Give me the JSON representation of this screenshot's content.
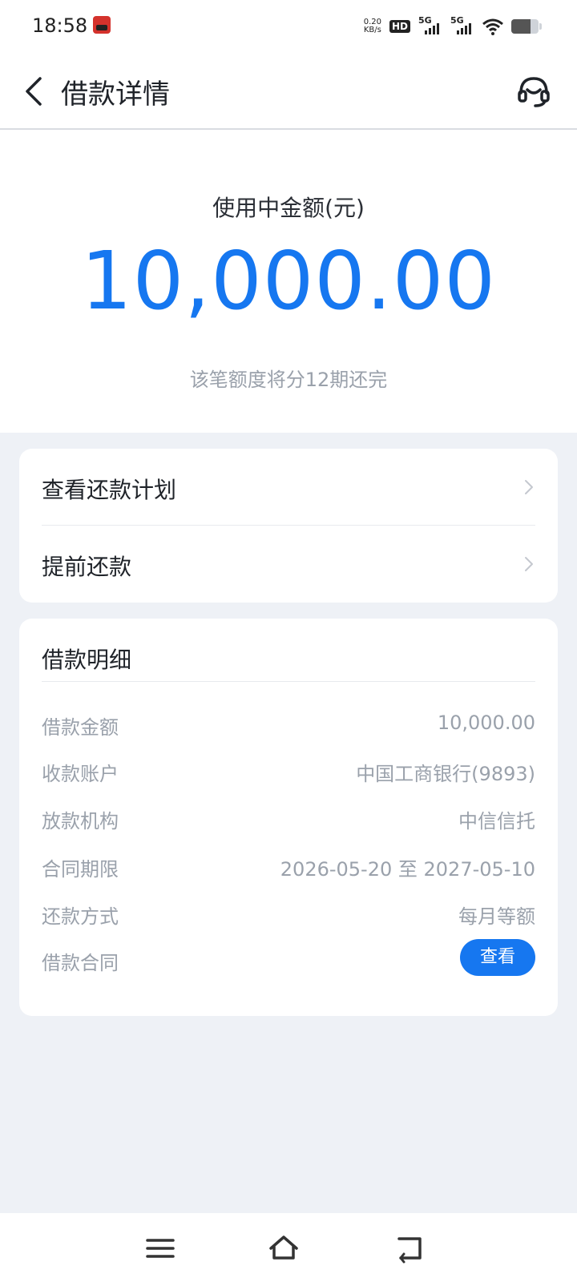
{
  "status": {
    "time": "18:58",
    "net_speed_value": "0.20",
    "net_speed_unit": "KB/s",
    "hd_label": "HD",
    "signal_label_1": "5G",
    "signal_label_2": "5G"
  },
  "header": {
    "title": "借款详情"
  },
  "summary": {
    "label": "使用中金额(元)",
    "amount": "10,000.00",
    "note": "该笔额度将分12期还完"
  },
  "actions": [
    {
      "label": "查看还款计划"
    },
    {
      "label": "提前还款"
    }
  ],
  "details": {
    "title": "借款明细",
    "rows": [
      {
        "key": "借款金额",
        "value": "10,000.00"
      },
      {
        "key": "收款账户",
        "value": "中国工商银行(9893)"
      },
      {
        "key": "放款机构",
        "value": "中信信托"
      },
      {
        "key": "合同期限",
        "value": "2026-05-20 至 2027-05-10"
      },
      {
        "key": "还款方式",
        "value": "每月等额"
      },
      {
        "key": "借款合同",
        "button": "查看"
      }
    ]
  },
  "colors": {
    "accent": "#1677f0",
    "page_bg": "#eef1f6"
  },
  "icons": {
    "back": "chevron-left-icon",
    "service": "headset-icon",
    "menu": "menu-icon",
    "home": "home-icon",
    "return": "return-icon"
  }
}
